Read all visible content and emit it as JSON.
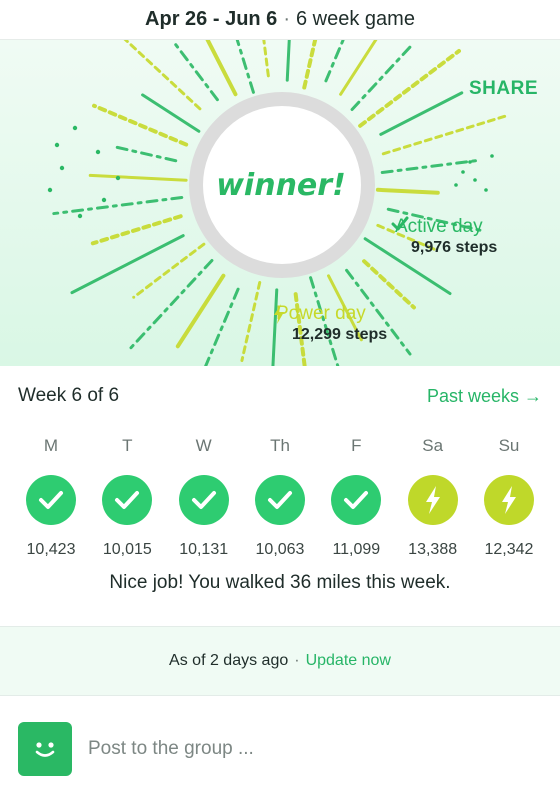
{
  "header": {
    "date_range": "Apr 26 - Jun 6",
    "game_length": "6 week game"
  },
  "hero": {
    "share_label": "SHARE",
    "winner_label": "winner!",
    "active_day": {
      "label": "Active day",
      "steps": "9,976 steps"
    },
    "power_day": {
      "label": "Power day",
      "steps": "12,299 steps"
    },
    "colors": {
      "green": "#2ab864",
      "lime": "#c6d92a"
    }
  },
  "week": {
    "title": "Week 6 of 6",
    "past_weeks_label": "Past weeks →",
    "days": [
      {
        "label": "M",
        "steps": "10,423",
        "status": "check"
      },
      {
        "label": "T",
        "steps": "10,015",
        "status": "check"
      },
      {
        "label": "W",
        "steps": "10,131",
        "status": "check"
      },
      {
        "label": "Th",
        "steps": "10,063",
        "status": "check"
      },
      {
        "label": "F",
        "steps": "11,099",
        "status": "check"
      },
      {
        "label": "Sa",
        "steps": "13,388",
        "status": "bolt"
      },
      {
        "label": "Su",
        "steps": "12,342",
        "status": "bolt"
      }
    ],
    "summary": "Nice job! You walked 36 miles this week."
  },
  "update": {
    "as_of": "As of 2 days ago",
    "update_link": "Update now"
  },
  "post": {
    "placeholder": "Post to the group ...",
    "avatar_icon": "smiley-icon"
  }
}
